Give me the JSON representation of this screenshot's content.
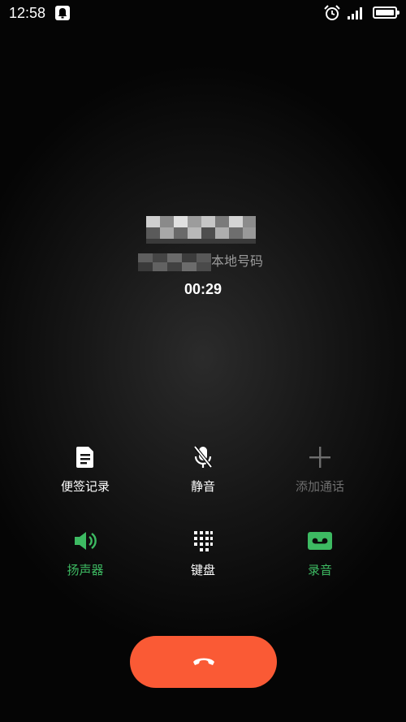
{
  "status_bar": {
    "time": "12:58",
    "icons": [
      "notification-icon",
      "alarm-icon",
      "signal-icon",
      "battery-icon"
    ]
  },
  "call": {
    "caller_name": "",
    "caller_location": "本地号码",
    "duration": "00:29"
  },
  "controls": {
    "notes_label": "便签记录",
    "mute_label": "静音",
    "add_call_label": "添加通话",
    "speaker_label": "扬声器",
    "keypad_label": "键盘",
    "record_label": "录音"
  },
  "colors": {
    "accent_green": "#3dba62",
    "end_call": "#fa5a35",
    "disabled": "#6e6e6e"
  }
}
